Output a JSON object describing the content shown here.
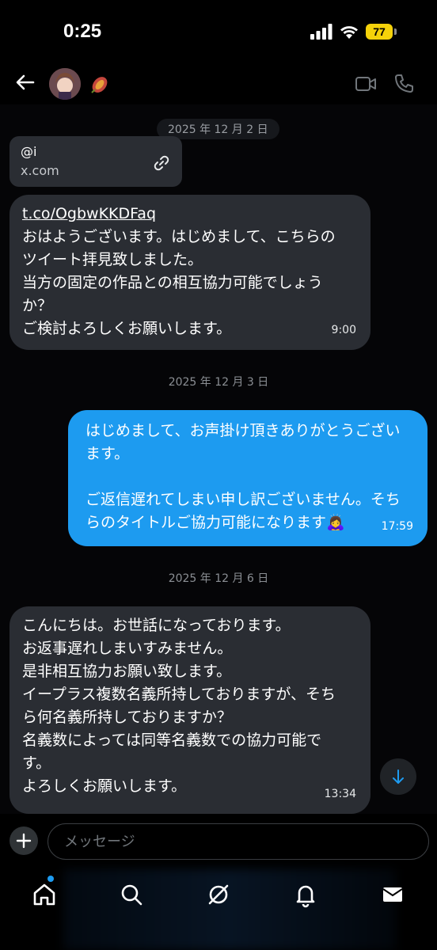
{
  "status_bar": {
    "time": "0:25",
    "battery": "77"
  },
  "header": {
    "icons": [
      "back-arrow-icon",
      "avatar",
      "sweet-potato-emoji",
      "video-camera-icon",
      "phone-icon"
    ]
  },
  "dates": [
    "2025 年 12 月 2 日",
    "2025 年 12 月 3 日",
    "2025 年 12 月 6 日"
  ],
  "link_card": {
    "handle": "@i",
    "domain": "x.com"
  },
  "messages": [
    {
      "direction": "incoming",
      "link": "t.co/OgbwKKDFaq",
      "text": "おはようございます。はじめまして、こちらの\nツイート拝見致しました。\n当方の固定の作品との相互協力可能でしょう\nか？\nご検討よろしくお願いします。",
      "time": "9:00"
    },
    {
      "direction": "outgoing",
      "text": "はじめまして、お声掛け頂きありがとうござい\nます。\n\nご返信遅れてしまい申し訳ございません。そち\nらのタイトルご協力可能になります🙇‍♀️",
      "time": "17:59"
    },
    {
      "direction": "incoming",
      "text": "こんにちは。お世話になっております。\nお返事遅れしまいすみません。\n是非相互協力お願い致します。\nイープラス複数名義所持しておりますが、そち\nら何名義所持しておりますか？\n名義数によっては同等名義数での協力可能で\nす。\nよろしくお願いします。",
      "time": "13:34"
    }
  ],
  "composer": {
    "placeholder": "メッセージ"
  },
  "tabbar": {
    "icons": [
      "home-icon",
      "search-icon",
      "grok-icon",
      "bell-icon",
      "mail-icon"
    ]
  },
  "colors": {
    "outgoing_bubble": "#1d9bf0",
    "incoming_bubble": "#2a2d33",
    "battery": "#f5d20a"
  }
}
